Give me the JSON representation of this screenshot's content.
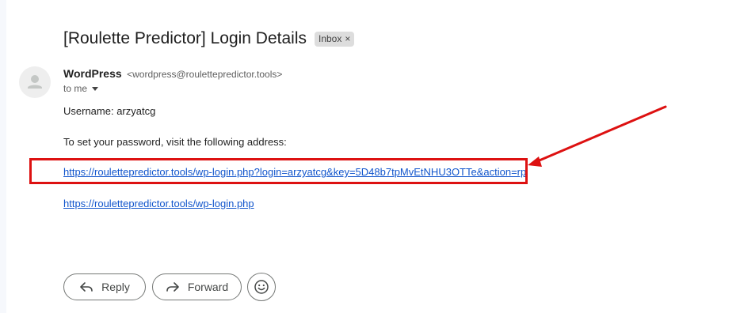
{
  "email": {
    "subject": "[Roulette Predictor] Login Details",
    "label_chip": "Inbox",
    "label_chip_close": "×",
    "sender_name": "WordPress",
    "sender_email": "<wordpress@roulettepredictor.tools>",
    "recipient": "to me",
    "body": {
      "username_line": "Username: arzyatcg",
      "instruction_line": "To set your password, visit the following address:",
      "reset_link": "https://roulettepredictor.tools/wp-login.php?login=arzyatcg&key=5D48b7tpMvEtNHU3OTTe&action=rp",
      "login_link": "https://roulettepredictor.tools/wp-login.php"
    }
  },
  "actions": {
    "reply_label": "Reply",
    "forward_label": "Forward"
  },
  "icons": {
    "avatar": "person-icon",
    "reply": "reply-arrow-icon",
    "forward": "forward-arrow-icon",
    "emoji": "smiley-icon",
    "recipient_details": "chevron-down-icon"
  },
  "colors": {
    "link": "#1155cc",
    "annotation": "#dd1111"
  }
}
